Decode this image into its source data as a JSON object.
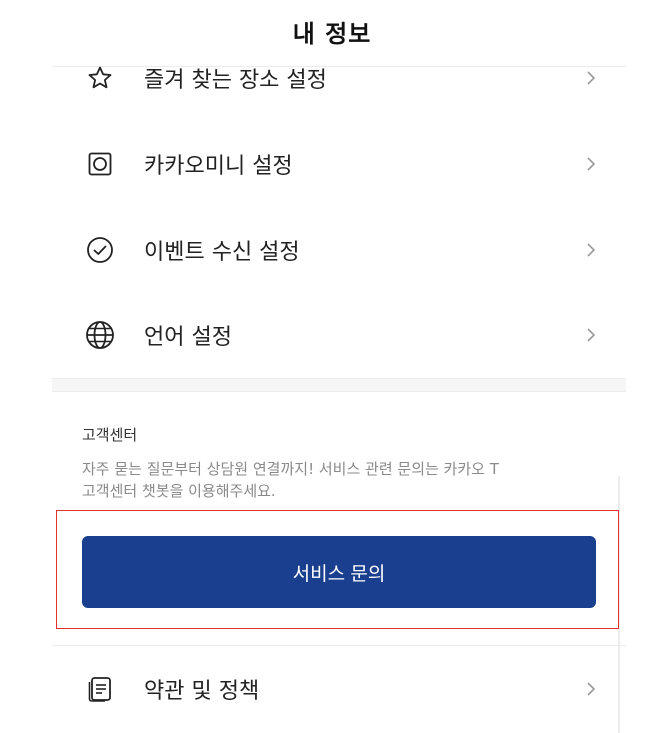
{
  "header": {
    "title": "내 정보"
  },
  "menu": [
    {
      "label": "즐겨 찾는 장소 설정",
      "icon": "star-icon"
    },
    {
      "label": "카카오미니 설정",
      "icon": "speaker-icon"
    },
    {
      "label": "이벤트 수신 설정",
      "icon": "check-circle-icon"
    },
    {
      "label": "언어 설정",
      "icon": "globe-icon"
    }
  ],
  "customer_center": {
    "title": "고객센터",
    "description_line1": "자주 묻는 질문부터 상담원 연결까지! 서비스 관련 문의는 카카오 T",
    "description_line2": "고객센터 챗봇을 이용해주세요.",
    "button_label": "서비스 문의"
  },
  "policy": {
    "label": "약관 및 정책",
    "icon": "document-icon"
  },
  "colors": {
    "button_bg": "#1a3f8f",
    "highlight_border": "#e0322b"
  }
}
